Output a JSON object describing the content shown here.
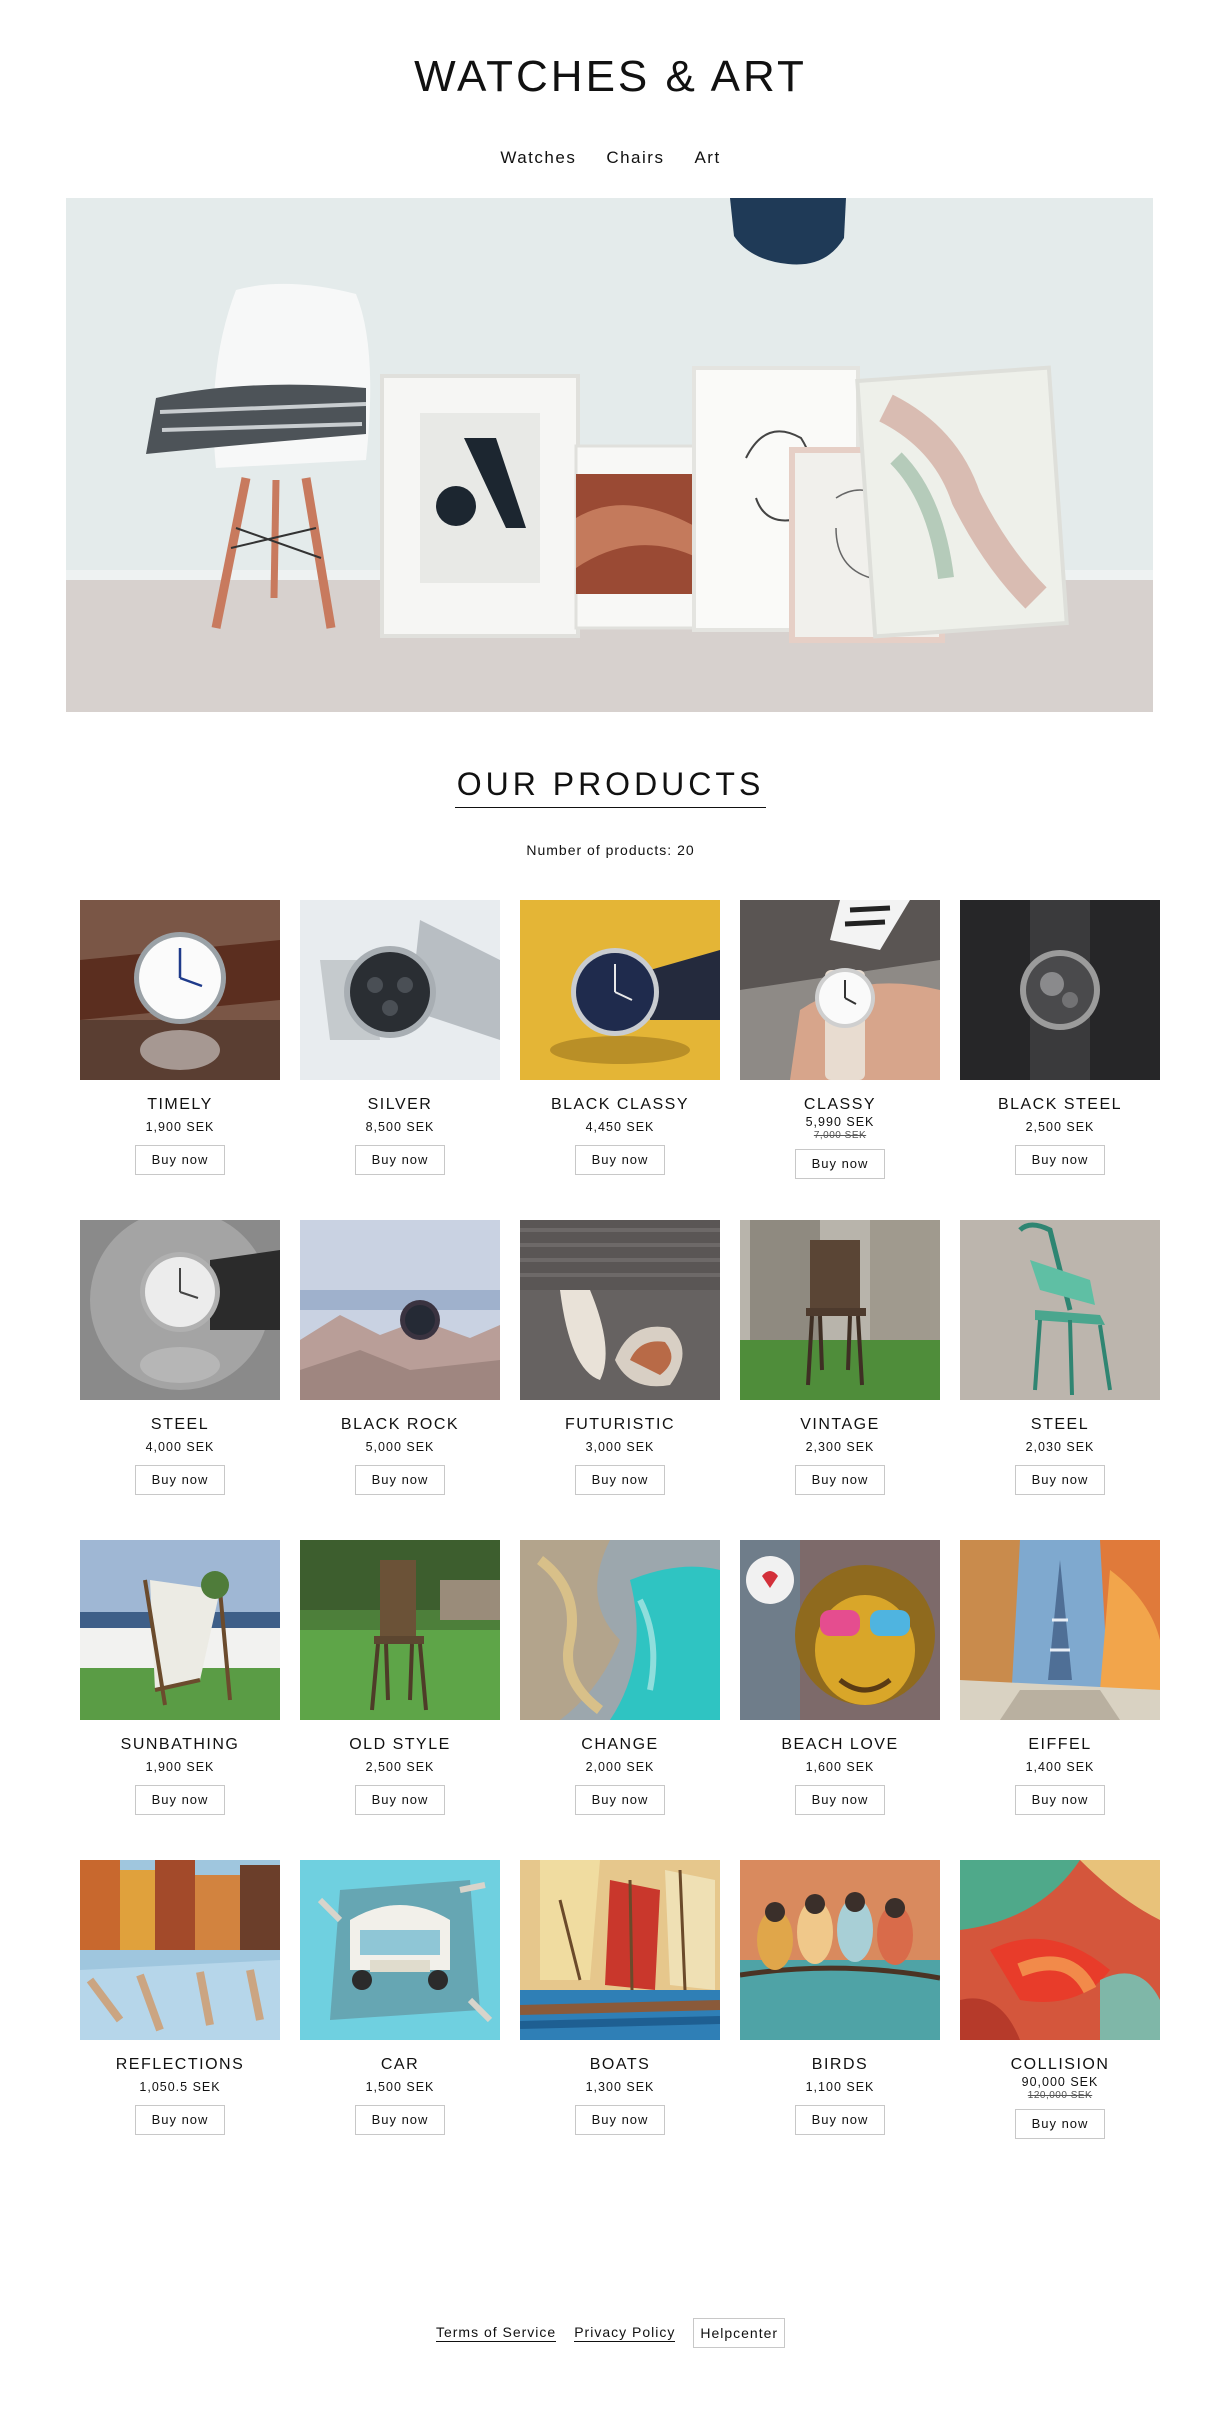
{
  "site": {
    "title": "WATCHES & ART"
  },
  "nav": {
    "items": [
      "Watches",
      "Chairs",
      "Art"
    ]
  },
  "hero": {
    "alt": "hero-image"
  },
  "products_section": {
    "title": "OUR PRODUCTS",
    "count_text": "Number of products: 20"
  },
  "buy_label": "Buy now",
  "products": [
    {
      "name": "TIMELY",
      "price": "1,900 SEK",
      "thumb": "watch-brown-strap"
    },
    {
      "name": "SILVER",
      "price": "8,500 SEK",
      "thumb": "watch-silver-chrono"
    },
    {
      "name": "BLACK CLASSY",
      "price": "4,450 SEK",
      "thumb": "watch-blue-on-yellow"
    },
    {
      "name": "CLASSY",
      "price": "5,990 SEK",
      "old_price": "7,000 SEK",
      "thumb": "watch-on-wrist"
    },
    {
      "name": "BLACK STEEL",
      "price": "2,500 SEK",
      "thumb": "watch-dark-skeleton"
    },
    {
      "name": "STEEL",
      "price": "4,000 SEK",
      "thumb": "watch-grayscale"
    },
    {
      "name": "BLACK ROCK",
      "price": "5,000 SEK",
      "thumb": "watch-on-rocks"
    },
    {
      "name": "FUTURISTIC",
      "price": "3,000 SEK",
      "thumb": "chair-futuristic"
    },
    {
      "name": "VINTAGE",
      "price": "2,300 SEK",
      "thumb": "chair-vintage"
    },
    {
      "name": "STEEL",
      "price": "2,030 SEK",
      "thumb": "chair-green-steel"
    },
    {
      "name": "SUNBATHING",
      "price": "1,900 SEK",
      "thumb": "chair-deck"
    },
    {
      "name": "OLD STYLE",
      "price": "2,500 SEK",
      "thumb": "chair-old-wooden"
    },
    {
      "name": "CHANGE",
      "price": "2,000 SEK",
      "thumb": "art-aerial-coast"
    },
    {
      "name": "BEACH LOVE",
      "price": "1,600 SEK",
      "thumb": "art-monkey-graffiti"
    },
    {
      "name": "EIFFEL",
      "price": "1,400 SEK",
      "thumb": "art-eiffel-painting"
    },
    {
      "name": "REFLECTIONS",
      "price": "1,050.5 SEK",
      "thumb": "art-reflections"
    },
    {
      "name": "CAR",
      "price": "1,500 SEK",
      "thumb": "art-car-wall"
    },
    {
      "name": "BOATS",
      "price": "1,300 SEK",
      "thumb": "art-sailboats"
    },
    {
      "name": "BIRDS",
      "price": "1,100 SEK",
      "thumb": "art-birds-on-branch"
    },
    {
      "name": "COLLISION",
      "price": "90,000 SEK",
      "old_price": "120,000 SEK",
      "thumb": "art-abstract-red"
    }
  ],
  "footer": {
    "terms": "Terms of Service",
    "privacy": "Privacy Policy",
    "help": "Helpcenter"
  }
}
